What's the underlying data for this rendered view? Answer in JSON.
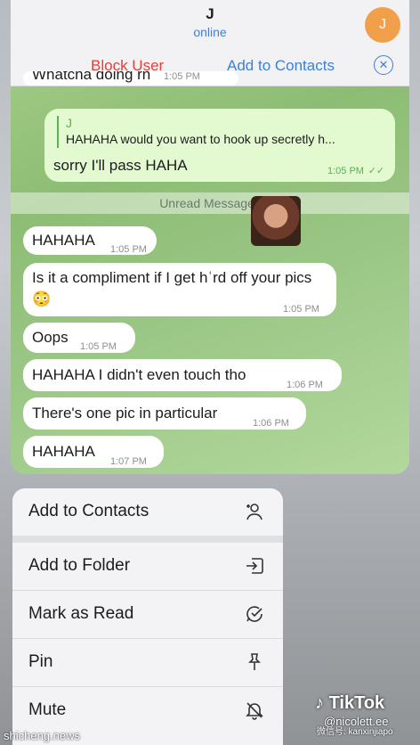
{
  "header": {
    "contact_name": "J",
    "status": "online",
    "avatar_initial": "J",
    "block_user": "Block User",
    "add_to_contacts": "Add to Contacts"
  },
  "messages": {
    "partial_top": "Whatcha doing rn",
    "partial_top_time": "1:05 PM",
    "reply_sender": "J",
    "reply_quote": "HAHAHA would you want to hook up secretly h...",
    "outgoing_text": "sorry I'll pass HAHA",
    "outgoing_time": "1:05 PM",
    "unread_label": "Unread Messages",
    "incoming": [
      {
        "text": "HAHAHA",
        "time": "1:05 PM"
      },
      {
        "text": "Is it a compliment if I get hʿrd off your pics 😳",
        "time": "1:05 PM"
      },
      {
        "text": "Oops",
        "time": "1:05 PM"
      },
      {
        "text": "HAHAHA I didn't even touch tho",
        "time": "1:06 PM"
      },
      {
        "text": "There's one pic in particular",
        "time": "1:06 PM"
      },
      {
        "text": "HAHAHA",
        "time": "1:07 PM"
      }
    ]
  },
  "menu": {
    "items": [
      {
        "label": "Add to Contacts",
        "icon": "add-contact-icon"
      },
      {
        "label": "Add to Folder",
        "icon": "folder-arrow-icon"
      },
      {
        "label": "Mark as Read",
        "icon": "mark-read-icon"
      },
      {
        "label": "Pin",
        "icon": "pin-icon"
      },
      {
        "label": "Mute",
        "icon": "mute-bell-icon"
      }
    ]
  },
  "watermarks": {
    "site": "shicheng.news",
    "tiktok": "TikTok",
    "handle": "@nicolett.ee",
    "wechat": "微信号: kanxinjiapo"
  },
  "colors": {
    "accent_blue": "#3f7fd6",
    "destructive_red": "#e0413a",
    "outgoing_bubble": "#e3f9cf",
    "avatar_orange": "#f0a04a"
  }
}
